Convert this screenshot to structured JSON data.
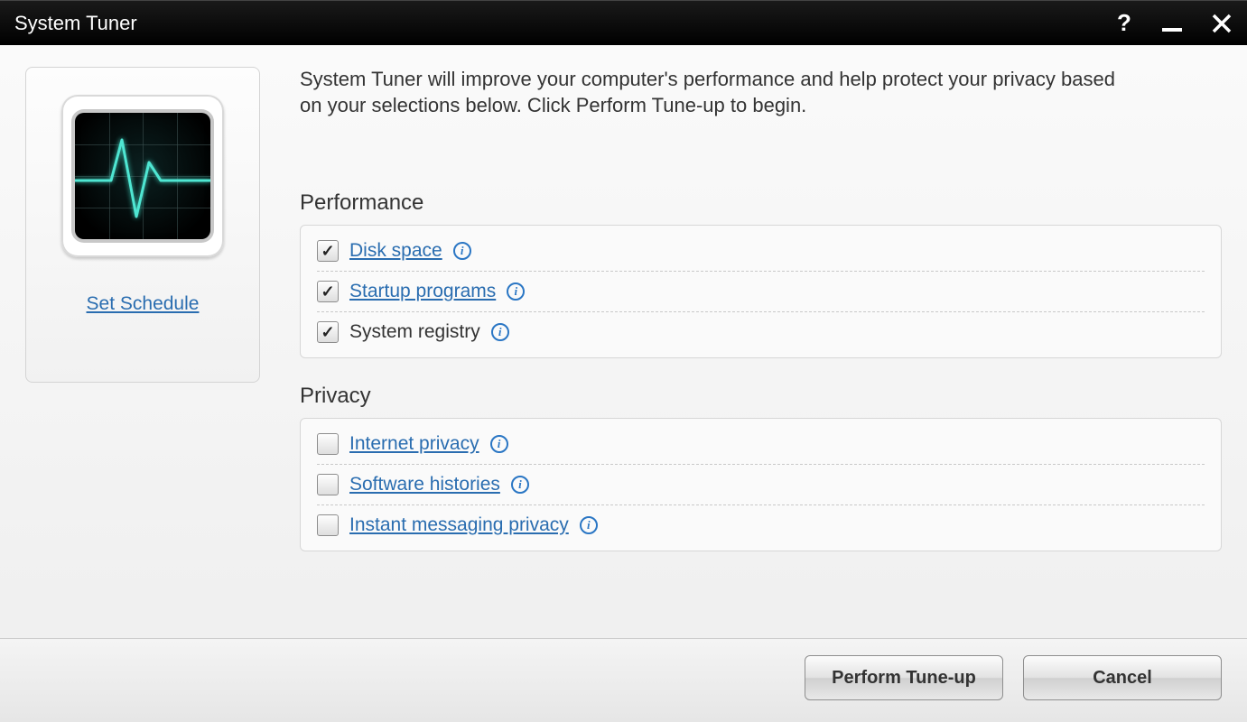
{
  "titlebar": {
    "title": "System Tuner"
  },
  "intro": "System Tuner will improve your computer's performance and help protect your privacy based on your selections below. Click Perform Tune-up to begin.",
  "sidebar": {
    "schedule_link": "Set Schedule"
  },
  "sections": {
    "performance": {
      "heading": "Performance",
      "items": [
        {
          "label": "Disk space",
          "checked": true,
          "link": true
        },
        {
          "label": "Startup programs",
          "checked": true,
          "link": true
        },
        {
          "label": "System registry",
          "checked": true,
          "link": false
        }
      ]
    },
    "privacy": {
      "heading": "Privacy",
      "items": [
        {
          "label": "Internet privacy",
          "checked": false,
          "link": true
        },
        {
          "label": "Software histories",
          "checked": false,
          "link": true
        },
        {
          "label": "Instant messaging privacy",
          "checked": false,
          "link": true
        }
      ]
    }
  },
  "footer": {
    "perform": "Perform Tune-up",
    "cancel": "Cancel"
  }
}
